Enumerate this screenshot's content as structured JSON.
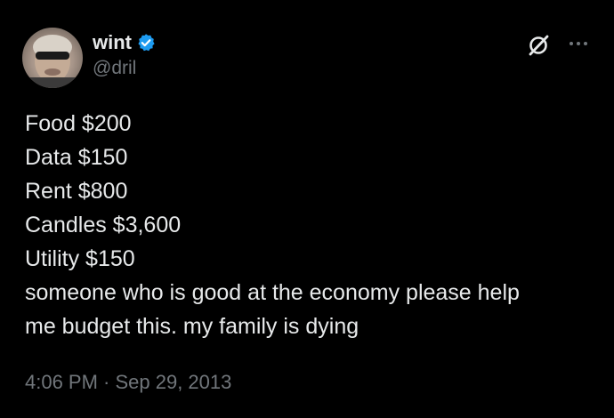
{
  "author": {
    "display_name": "wint",
    "handle": "@dril",
    "verified": true,
    "verified_color": "#1d9bf0"
  },
  "header_icons": {
    "grok": "grok-icon",
    "more": "more-icon"
  },
  "tweet": {
    "lines": [
      "Food $200",
      "Data $150",
      "Rent $800",
      "Candles $3,600",
      "Utility $150",
      "someone who is good at the economy please help",
      "me budget this. my family is dying"
    ],
    "timestamp": "4:06 PM · Sep 29, 2013"
  },
  "colors": {
    "background": "#000000",
    "text_primary": "#e7e9ea",
    "text_secondary": "#71767b"
  }
}
